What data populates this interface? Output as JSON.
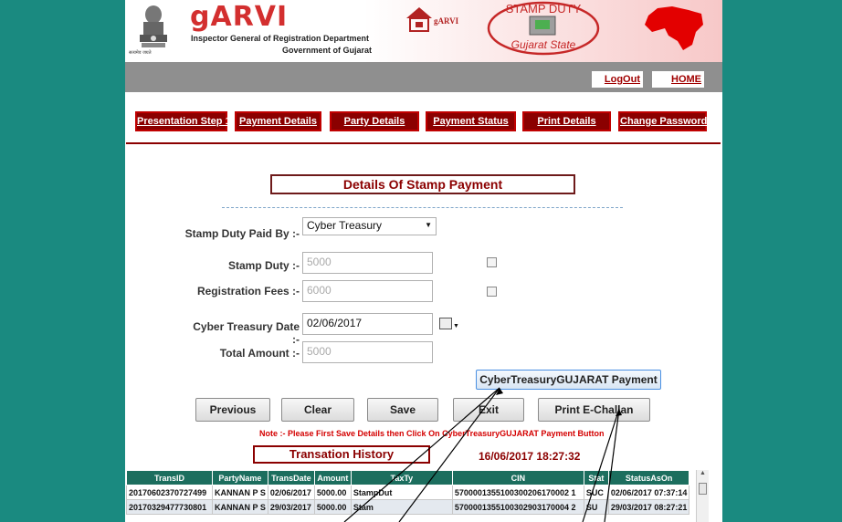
{
  "header": {
    "emblem_caption": "सत्यमेव जयते",
    "app_name": "gARVI",
    "department": "Inspector General of Registration Department",
    "government": "Government of Gujarat",
    "small_logo_text": "gARVI",
    "stamp_logo_line1": "STAMP DUTY",
    "stamp_logo_line2": "Gujarat State"
  },
  "top_links": {
    "logout": "LogOut",
    "home": "HOME"
  },
  "nav": [
    {
      "label": "Presentation Step 1"
    },
    {
      "label": "Payment Details"
    },
    {
      "label": "Party Details"
    },
    {
      "label": "Payment Status"
    },
    {
      "label": "Print Details"
    },
    {
      "label": "Change Password"
    }
  ],
  "form": {
    "title": "Details Of Stamp Payment",
    "paid_by_label": "Stamp Duty Paid By :-",
    "paid_by_value": "Cyber Treasury",
    "stamp_duty_label": "Stamp Duty :-",
    "stamp_duty_value": "5000",
    "reg_fees_label": "Registration Fees :-",
    "reg_fees_value": "6000",
    "ct_date_label": "Cyber Treasury Date :-",
    "ct_date_value": "02/06/2017",
    "total_label": "Total Amount :-",
    "total_value": "5000"
  },
  "buttons": {
    "cyber_payment": "CyberTreasuryGUJARAT Payment",
    "previous": "Previous",
    "clear": "Clear",
    "save": "Save",
    "exit": "Exit",
    "print_challan": "Print E-Challan"
  },
  "note": "Note :- Please First Save Details then Click On CyberTreasuryGUJARAT Payment Button",
  "history": {
    "title": "Transation History",
    "timestamp": "16/06/2017 18:27:32",
    "columns": [
      "TransID",
      "PartyName",
      "TransDate",
      "Amount",
      "TaxTy",
      "CIN",
      "Stat",
      "StatusAsOn"
    ],
    "rows": [
      [
        "20170602370727499",
        "KANNAN P S",
        "02/06/2017",
        "5000.00",
        "StampDut",
        "5700001355100300206170002 1",
        "SUC",
        "02/06/2017 07:37:14"
      ],
      [
        "20170329477730801",
        "KANNAN P S",
        "29/03/2017",
        "5000.00",
        "Stam",
        "5700001355100302903170004 2",
        "SU",
        "29/03/2017 08:27:21"
      ]
    ]
  },
  "colors": {
    "teal_side": "#1a8a80",
    "nav_red": "#8b0000",
    "table_header": "#1c6e5e",
    "note_red": "#d40000"
  }
}
